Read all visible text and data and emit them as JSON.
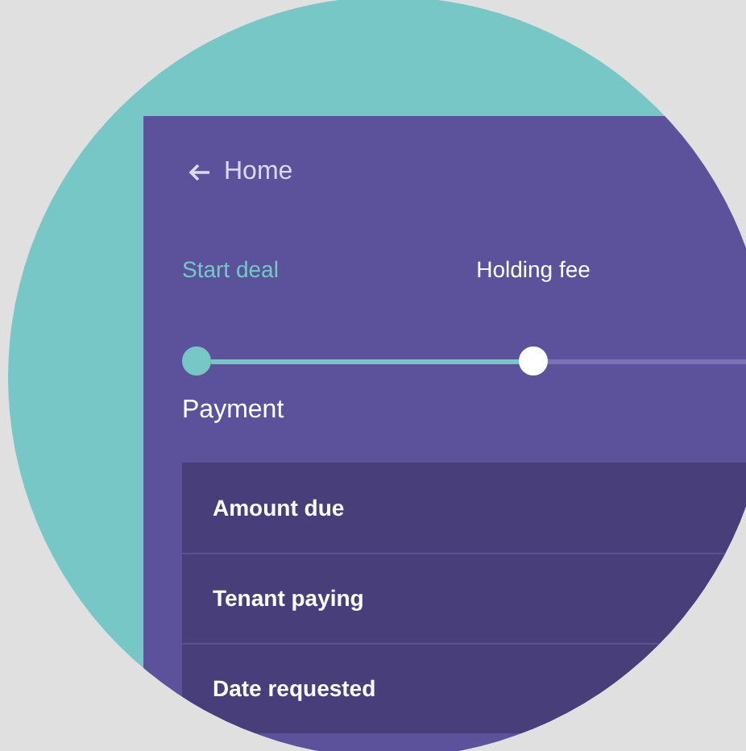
{
  "header": {
    "back_label": "Home"
  },
  "steps": [
    {
      "label": "Start deal",
      "selected": false
    },
    {
      "label": "Holding fee",
      "selected": true
    }
  ],
  "section_title": "Payment",
  "rows": [
    {
      "label": "Amount due"
    },
    {
      "label": "Tenant paying"
    },
    {
      "label": "Date requested"
    }
  ]
}
